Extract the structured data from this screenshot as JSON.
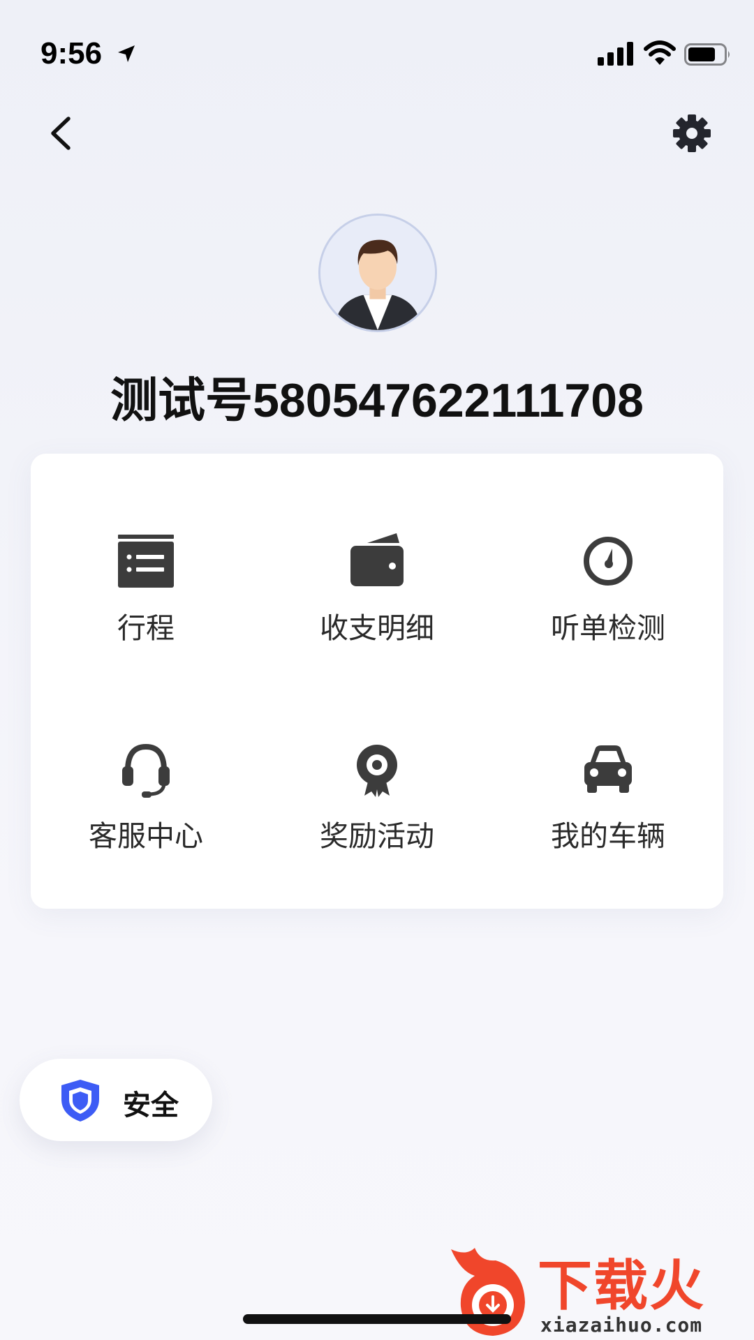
{
  "status_bar": {
    "time": "9:56",
    "icons": [
      "location-arrow-icon",
      "cellular-signal-icon",
      "wifi-icon",
      "battery-icon"
    ]
  },
  "nav": {
    "back_icon": "chevron-left-icon",
    "settings_icon": "gear-icon"
  },
  "profile": {
    "avatar_icon": "user-avatar",
    "name": "测试号580547622111708"
  },
  "menu": {
    "items": [
      {
        "label": "行程",
        "icon": "itinerary-list-icon"
      },
      {
        "label": "收支明细",
        "icon": "wallet-icon"
      },
      {
        "label": "听单检测",
        "icon": "gauge-icon"
      },
      {
        "label": "客服中心",
        "icon": "headset-icon"
      },
      {
        "label": "奖励活动",
        "icon": "award-badge-icon"
      },
      {
        "label": "我的车辆",
        "icon": "car-icon"
      }
    ]
  },
  "safety": {
    "label": "安全",
    "icon": "shield-icon",
    "color": "#3d5cf5"
  },
  "watermark": {
    "text": "下载火",
    "url": "xiazaihuo.com",
    "color": "#f0462b"
  },
  "colors": {
    "icon": "#3c3c3c",
    "background": "#f2f3f9"
  }
}
